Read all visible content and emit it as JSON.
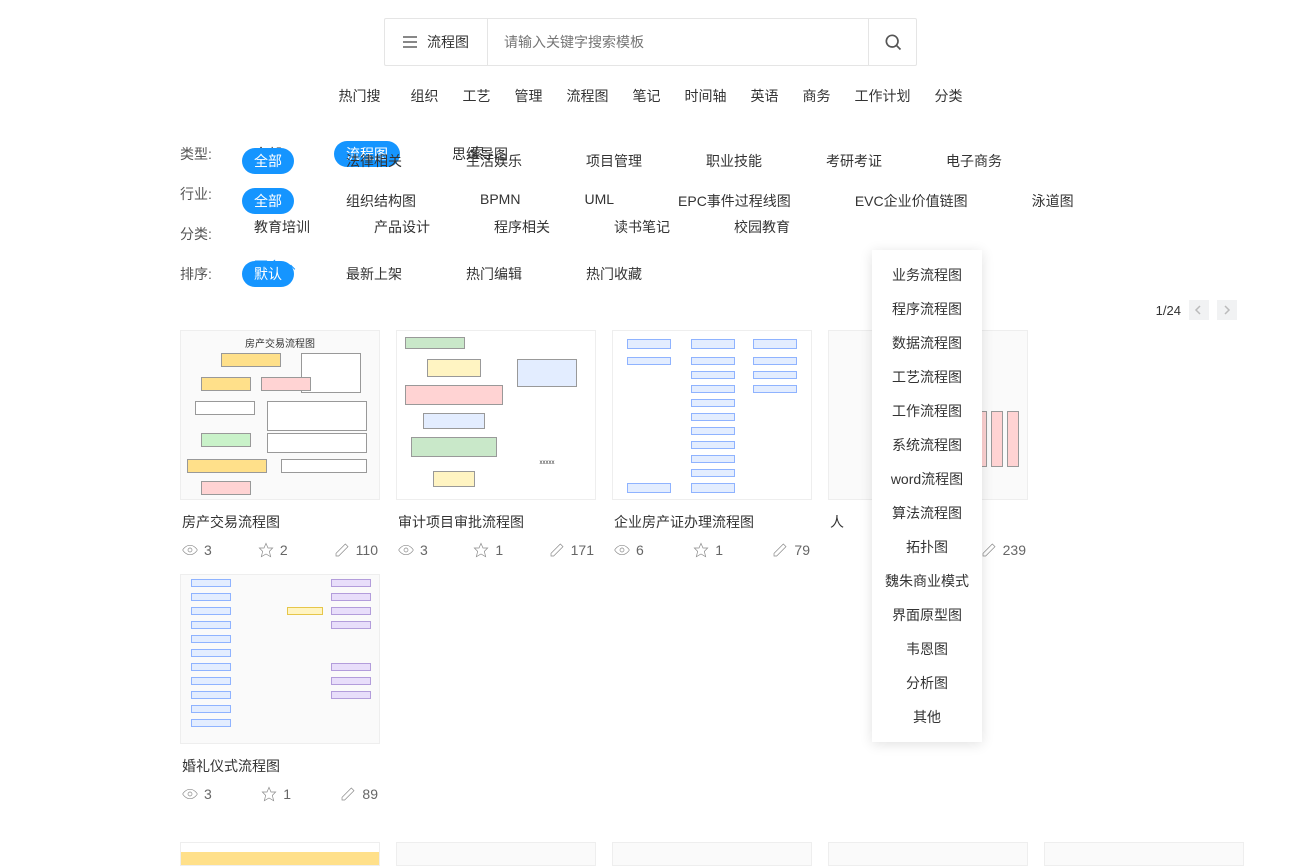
{
  "search": {
    "category": "流程图",
    "placeholder": "请输入关键字搜索模板"
  },
  "hot": {
    "label": "热门搜索:",
    "label_short": "热门搜",
    "tags": [
      "组织",
      "工艺",
      "管理",
      "流程图",
      "笔记",
      "时间轴",
      "英语",
      "商务",
      "工作计划",
      "分类"
    ]
  },
  "filters": {
    "type": {
      "label": "类型:",
      "opts": [
        "全部",
        "流程图",
        "思维导图"
      ],
      "active": 1
    },
    "industry": {
      "label": "行业:",
      "opts": [
        "全部",
        "法律相关",
        "生活娱乐",
        "项目管理",
        "职业技能",
        "考研考证",
        "电子商务",
        "教育培训",
        "产品设计",
        "程序相关",
        "读书笔记",
        "校园教育"
      ],
      "active": 0
    },
    "category": {
      "label": "分类:",
      "opts": [
        "全部",
        "组织结构图",
        "BPMN",
        "UML",
        "EPC事件过程线图",
        "EVC企业价值链图",
        "泳道图"
      ],
      "active": 0,
      "more": "更多"
    },
    "sort": {
      "label": "排序:",
      "opts": [
        "默认",
        "最新上架",
        "热门编辑",
        "热门收藏"
      ],
      "active": 0
    }
  },
  "dropdown": [
    "业务流程图",
    "程序流程图",
    "数据流程图",
    "工艺流程图",
    "工作流程图",
    "系统流程图",
    "word流程图",
    "算法流程图",
    "拓扑图",
    "魏朱商业模式",
    "界面原型图",
    "韦恩图",
    "分析图",
    "其他"
  ],
  "pager": {
    "current": 1,
    "total": 24
  },
  "cards": [
    {
      "thumb": "t1",
      "title": "房产交易流程图",
      "views": 3,
      "stars": 2,
      "edits": 110
    },
    {
      "thumb": "t2",
      "title": "审计项目审批流程图",
      "views": 3,
      "stars": 1,
      "edits": 171
    },
    {
      "thumb": "t3",
      "title": "企业房产证办理流程图",
      "views": 6,
      "stars": 1,
      "edits": 79
    },
    {
      "thumb": "t4",
      "title": "人",
      "views": "",
      "stars": "",
      "edits": 239
    },
    {
      "thumb": "t5",
      "title": "婚礼仪式流程图",
      "views": 3,
      "stars": 1,
      "edits": 89
    }
  ]
}
